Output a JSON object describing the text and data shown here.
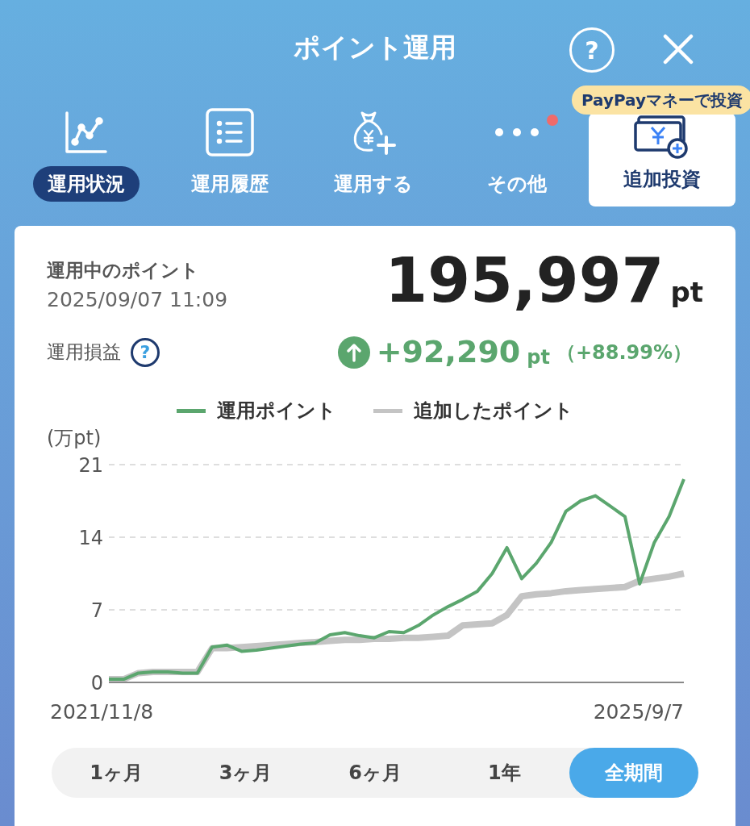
{
  "header": {
    "title": "ポイント運用",
    "help": "?"
  },
  "tabs": [
    {
      "label": "運用状況",
      "kind": "tab",
      "selected": true
    },
    {
      "label": "運用履歴",
      "kind": "tab",
      "selected": false
    },
    {
      "label": "運用する",
      "kind": "tab",
      "selected": false
    },
    {
      "label": "その他",
      "kind": "tab",
      "selected": false,
      "notification": true
    },
    {
      "label": "追加投資",
      "kind": "card",
      "selected": false,
      "badge": "PayPayマネーで投資"
    }
  ],
  "summary": {
    "label": "運用中のポイント",
    "timestamp": "2025/09/07 11:09",
    "value": "195,997",
    "unit": "pt",
    "profit_label": "運用損益",
    "profit_help": "?",
    "profit": "+92,290",
    "profit_unit": "pt",
    "profit_percent": "（+88.99%）"
  },
  "chart": {
    "start_label": "2021/11/8",
    "end_label": "2025/9/7",
    "chart_data": {
      "type": "line",
      "ylabel": "(万pt)",
      "yticks": [
        0,
        7,
        14,
        21
      ],
      "ylim": [
        0,
        21
      ],
      "series": [
        {
          "name": "運用ポイント",
          "color": "#5ba66e",
          "values": [
            0.3,
            0.3,
            0.9,
            1.0,
            1.0,
            0.9,
            0.9,
            3.4,
            3.6,
            3.0,
            3.1,
            3.3,
            3.5,
            3.7,
            3.8,
            4.6,
            4.8,
            4.5,
            4.3,
            4.9,
            4.8,
            5.5,
            6.5,
            7.3,
            8.0,
            8.8,
            10.5,
            13.0,
            10.0,
            11.5,
            13.5,
            16.5,
            17.5,
            18.0,
            17.0,
            16.0,
            9.5,
            13.5,
            16.0,
            19.6
          ]
        },
        {
          "name": "追加したポイント",
          "color": "#c4c4c4",
          "values": [
            0.3,
            0.3,
            0.9,
            1.0,
            1.0,
            1.0,
            1.0,
            3.3,
            3.3,
            3.4,
            3.5,
            3.6,
            3.7,
            3.8,
            3.9,
            4.0,
            4.1,
            4.1,
            4.2,
            4.2,
            4.3,
            4.3,
            4.4,
            4.5,
            5.5,
            5.6,
            5.7,
            6.5,
            8.3,
            8.5,
            8.6,
            8.8,
            8.9,
            9.0,
            9.1,
            9.2,
            9.8,
            10.0,
            10.2,
            10.5
          ]
        }
      ]
    }
  },
  "periods": [
    {
      "label": "1ヶ月",
      "selected": false
    },
    {
      "label": "3ヶ月",
      "selected": false
    },
    {
      "label": "6ヶ月",
      "selected": false
    },
    {
      "label": "1年",
      "selected": false
    },
    {
      "label": "全期間",
      "selected": true
    }
  ]
}
